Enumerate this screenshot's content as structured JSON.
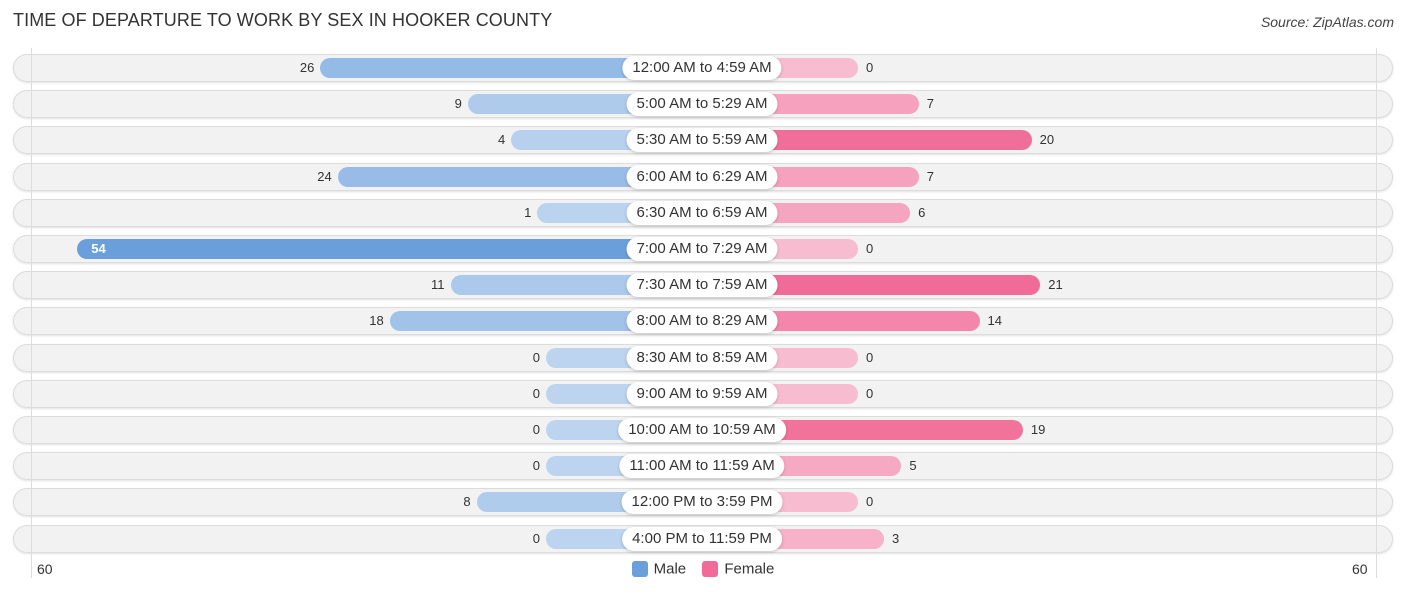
{
  "chart_data": {
    "type": "bar",
    "orientation": "horizontal-diverging",
    "title": "TIME OF DEPARTURE TO WORK BY SEX IN HOOKER COUNTY",
    "source": "Source: ZipAtlas.com",
    "categories": [
      "12:00 AM to 4:59 AM",
      "5:00 AM to 5:29 AM",
      "5:30 AM to 5:59 AM",
      "6:00 AM to 6:29 AM",
      "6:30 AM to 6:59 AM",
      "7:00 AM to 7:29 AM",
      "7:30 AM to 7:59 AM",
      "8:00 AM to 8:29 AM",
      "8:30 AM to 8:59 AM",
      "9:00 AM to 9:59 AM",
      "10:00 AM to 10:59 AM",
      "11:00 AM to 11:59 AM",
      "12:00 PM to 3:59 PM",
      "4:00 PM to 11:59 PM"
    ],
    "series": [
      {
        "name": "Male",
        "color": "#6a9fdc",
        "values": [
          26,
          9,
          4,
          24,
          1,
          54,
          11,
          18,
          0,
          0,
          0,
          0,
          8,
          0
        ]
      },
      {
        "name": "Female",
        "color": "#f06b97",
        "values": [
          0,
          7,
          20,
          7,
          6,
          0,
          21,
          14,
          0,
          0,
          19,
          5,
          0,
          3
        ]
      }
    ],
    "xlim": [
      -60,
      60
    ],
    "axis_labels": {
      "left": "60",
      "right": "60"
    },
    "legend": {
      "position": "bottom-center",
      "items": [
        "Male",
        "Female"
      ]
    },
    "grid": false
  }
}
